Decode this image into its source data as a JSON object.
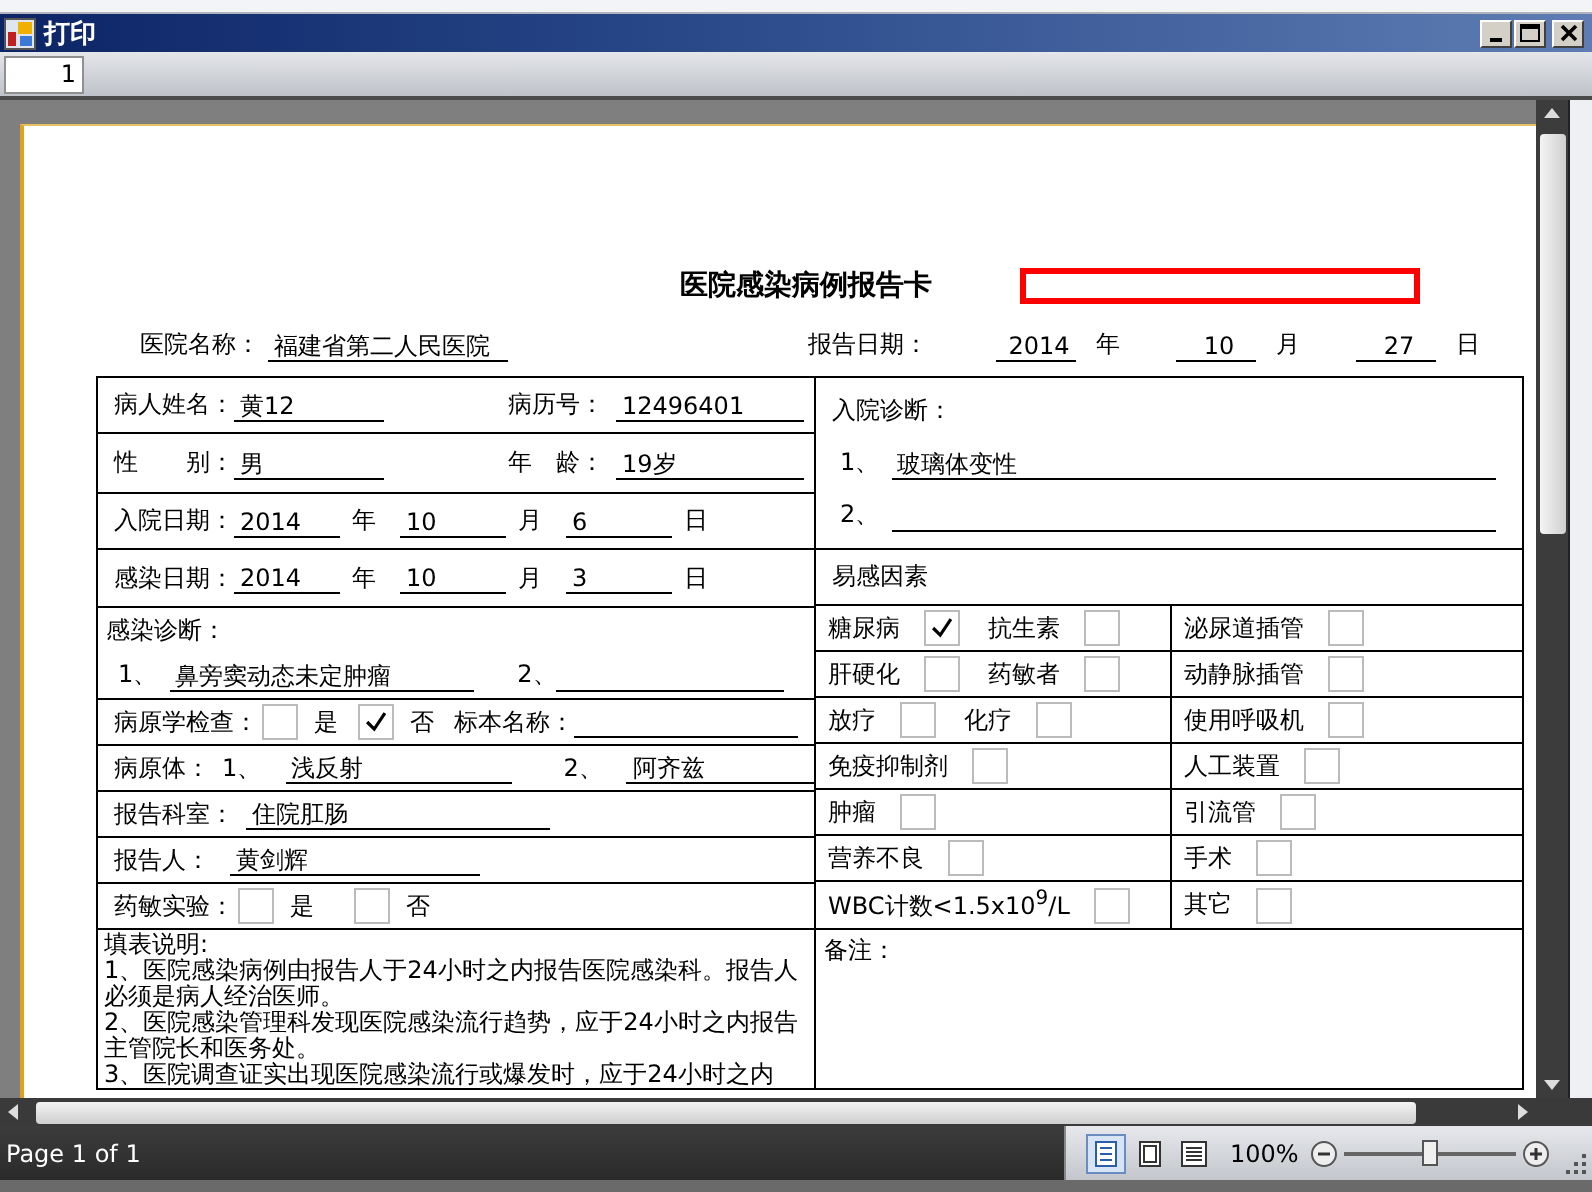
{
  "window": {
    "title": "打印"
  },
  "toolbar": {
    "page_number": "1"
  },
  "report": {
    "title": "医院感染病例报告卡",
    "hospital": {
      "label": "医院名称：",
      "value": "福建省第二人民医院"
    },
    "report_date": {
      "label": "报告日期：",
      "parts": [
        {
          "value": "2014",
          "unit": "年"
        },
        {
          "value": "10",
          "unit": "月"
        },
        {
          "value": "27",
          "unit": "日"
        }
      ]
    },
    "patient_name": {
      "label": "病人姓名：",
      "value": "黄12"
    },
    "record_number": {
      "label": "病历号：",
      "value": "12496401"
    },
    "sex": {
      "label": "性　　别：",
      "value": "男"
    },
    "age": {
      "label": "年　龄：",
      "value": "19岁"
    },
    "admission_date": {
      "label": "入院日期：",
      "parts": [
        {
          "value": "2014",
          "unit": "年"
        },
        {
          "value": "10",
          "unit": "月"
        },
        {
          "value": "6",
          "unit": "日"
        }
      ]
    },
    "infection_date": {
      "label": "感染日期：",
      "parts": [
        {
          "value": "2014",
          "unit": "年"
        },
        {
          "value": "10",
          "unit": "月"
        },
        {
          "value": "3",
          "unit": "日"
        }
      ]
    },
    "infection_diagnosis": {
      "label": "感染诊断：",
      "items": [
        {
          "index": "1、",
          "value": "鼻旁窦动态未定肿瘤"
        },
        {
          "index": "2、"
        }
      ]
    },
    "pathology_test": {
      "label": "病原学检查：",
      "options": [
        {
          "label": "是",
          "checked": false
        },
        {
          "label": "否",
          "checked": true
        }
      ],
      "specimen_label": "标本名称："
    },
    "pathogen": {
      "label": "病原体：",
      "items": [
        {
          "index": "1、",
          "value": "浅反射"
        },
        {
          "index": "2、",
          "value": "阿齐兹"
        }
      ]
    },
    "department": {
      "label": "报告科室：",
      "value": "住院肛肠"
    },
    "reporter": {
      "label": "报告人：",
      "value": "黄剑辉"
    },
    "drug_sensitivity_test": {
      "label": "药敏实验：",
      "options": [
        {
          "label": "是",
          "checked": false
        },
        {
          "label": "否",
          "checked": false
        }
      ]
    },
    "instructions": {
      "title": "填表说明:",
      "paragraphs": [
        "1、医院感染病例由报告人于24小时之内报告医院感染科。报告人必须是病人经治医师。",
        "2、医院感染管理科发现医院感染流行趋势，应于24小时之内报告主管院长和医务处。",
        "3、医院调查证实出现医院感染流行或爆发时，应于24小时之内"
      ]
    },
    "admission_diagnosis": {
      "label": "入院诊断：",
      "items": [
        {
          "index": "1、",
          "value": "玻璃体变性"
        },
        {
          "index": "2、"
        }
      ]
    },
    "susceptibility": {
      "label": "易感因素",
      "rows": [
        {
          "left": [
            {
              "label": "糖尿病",
              "checked": true
            },
            {
              "label": "抗生素",
              "checked": false
            }
          ],
          "right": [
            {
              "label": "泌尿道插管",
              "checked": false
            }
          ]
        },
        {
          "left": [
            {
              "label": "肝硬化",
              "checked": false
            },
            {
              "label": "药敏者",
              "checked": false
            }
          ],
          "right": [
            {
              "label": "动静脉插管",
              "checked": false
            }
          ]
        },
        {
          "left": [
            {
              "label": "放疗",
              "checked": false
            },
            {
              "label": "化疗",
              "checked": false
            }
          ],
          "right": [
            {
              "label": "使用呼吸机",
              "checked": false
            }
          ]
        },
        {
          "left": [
            {
              "label": "免疫抑制剂",
              "checked": false
            }
          ],
          "right": [
            {
              "label": "人工装置",
              "checked": false
            }
          ]
        },
        {
          "left": [
            {
              "label": "肿瘤",
              "checked": false
            }
          ],
          "right": [
            {
              "label": "引流管",
              "checked": false
            }
          ]
        },
        {
          "left": [
            {
              "label": "营养不良",
              "checked": false
            }
          ],
          "right": [
            {
              "label": "手术",
              "checked": false
            }
          ]
        },
        {
          "left": [
            {
              "label": "WBC计数<1.5x10$^{9}$/L",
              "checked": false
            }
          ],
          "right": [
            {
              "label": "其它",
              "checked": false
            }
          ]
        }
      ]
    },
    "remarks": {
      "label": "备注："
    }
  },
  "status_bar": {
    "page_info": "Page 1 of 1",
    "zoom": "100%",
    "zoom_slider": {
      "level": 0.5
    }
  }
}
